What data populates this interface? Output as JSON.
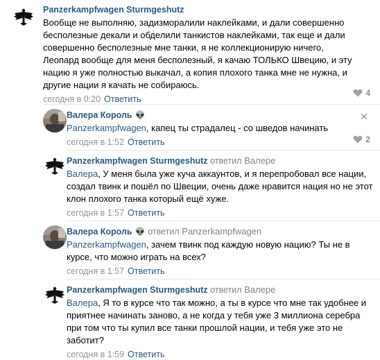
{
  "comments": [
    {
      "author": "Panzerkampfwagen Sturmgeshutz",
      "text": "Вообще не выполняю, задизморалили наклейками, и дали совершенно бесполезные декали и обделили танкистов наклейками, так еще и дали совершенно бесполезные мне танки, я не коллекционирую ничего, Леопард вообще для меня бесполезный, я качаю ТОЛЬКО Швецию, и эту нацию я уже полностью выкачал, а копия плохого танка мне не нужна, и другие нации я качать не собираюсь.",
      "time": "сегодня в 0:20",
      "reply_label": "Ответить",
      "likes": "4"
    },
    {
      "author": "Валера Король",
      "author_suffix": "👽",
      "mention": "Panzerkampfwagen",
      "text": ", капец ты страдалец - со шведов начинать",
      "time": "сегодня в 1:52",
      "reply_label": "Ответить",
      "likes": "2",
      "close": "✕"
    },
    {
      "author": "Panzerkampfwagen Sturmgeshutz",
      "replied": "ответил",
      "replied_to": "Валере",
      "mention": "Валера",
      "text": ", У меня была уже куча аккаунтов, и я перепробовал все нации, создал твинк и пошёл по Швеции, очень даже нравится нация но не этот клон плохого танка который ещё хуже.",
      "time": "сегодня в 1:57",
      "reply_label": "Ответить"
    },
    {
      "author": "Валера Король",
      "author_suffix": "👽",
      "replied": "ответил",
      "replied_to": "Panzerkampfwagen",
      "mention": "Panzerkampfwagen",
      "text": ", зачем твинк под каждую новую нацию? Ты не в курсе, что можно играть на всех?",
      "time": "сегодня в 1:57",
      "reply_label": "Ответить"
    },
    {
      "author": "Panzerkampfwagen Sturmgeshutz",
      "replied": "ответил",
      "replied_to": "Валере",
      "mention": "Валера",
      "text": ", Я то в курсе что так можно, а ты в курсе что мне так удобнее и приятнее начинать заново, а не когда у тебя уже 3 миллиона серебра при том что ты купил все танки прошлой нации, и тебя уже это не заботит?",
      "time": "сегодня в 1:59",
      "reply_label": "Ответить"
    }
  ],
  "colors": {
    "link": "#2a5885",
    "muted": "#939393",
    "divider": "#e7e8ec"
  },
  "icons": {
    "like": "heart-icon",
    "close": "close-icon",
    "eagle_avatar": "eagle-emblem-avatar",
    "photo_avatar": "user-photo-avatar"
  }
}
